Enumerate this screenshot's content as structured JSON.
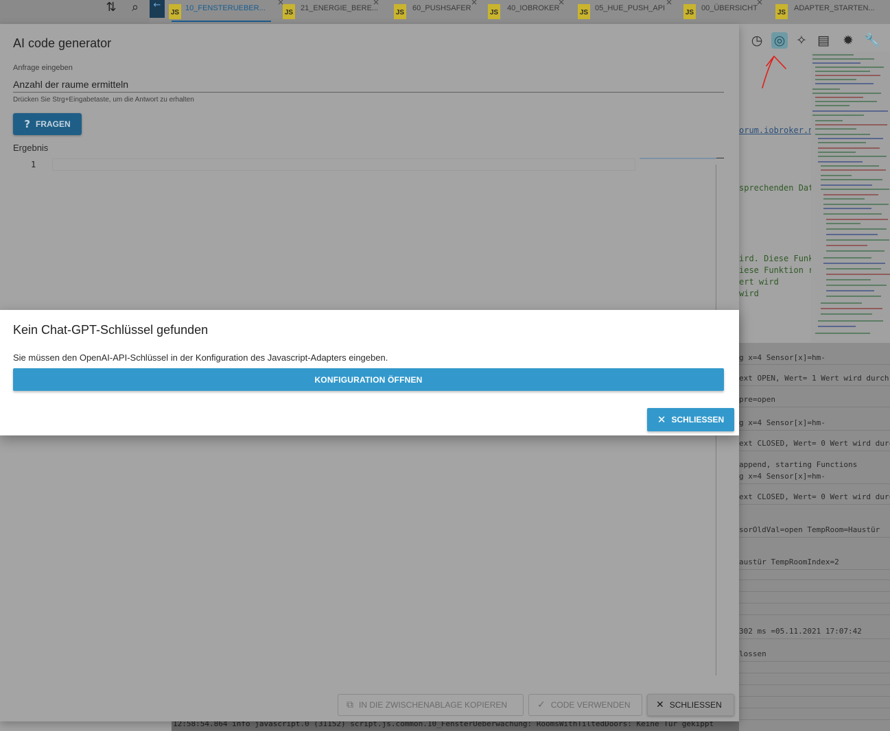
{
  "topbar": {
    "left_icons": [
      "sort-icon",
      "search-icon"
    ],
    "back_glyph": "←",
    "tabs": [
      {
        "badge": "JS",
        "name": "10_FENSTERUEBER...",
        "active": true
      },
      {
        "badge": "JS",
        "name": "21_ENERGIE_BERE..."
      },
      {
        "badge": "JS",
        "name": "60_PUSHSAFER"
      },
      {
        "badge": "JS",
        "name": "40_IOBROKER"
      },
      {
        "badge": "JS",
        "name": "05_HUE_PUSH_API"
      },
      {
        "badge": "JS",
        "name": "00_ÜBERSICHT"
      },
      {
        "badge": "JS",
        "name": "ADAPTER_STARTEN..."
      }
    ],
    "close_glyph": "×"
  },
  "right_toolbar": {
    "icons": [
      "clock-icon",
      "openai-icon",
      "sparkle-icon",
      "clipboard-icon",
      "bug-icon",
      "wrench-icon"
    ],
    "glyphs": [
      "◷",
      "◎",
      "✧",
      "▤",
      "✹",
      "🔧"
    ]
  },
  "code_snippets": [
    "orum.iobroker.n",
    "sprechenden Dat",
    "ird. Diese Funk",
    "iese Funktion r",
    "ert wird",
    "wird"
  ],
  "log_lines": [
    "g x=4 Sensor[x]=hm-",
    "ext OPEN, Wert= 1 Wert wird durch",
    "pre=open",
    "g x=4 Sensor[x]=hm-",
    "ext CLOSED, Wert= 0 Wert wird durch",
    "append, starting Functions",
    "g x=4 Sensor[x]=hm-",
    "ext CLOSED, Wert= 0 Wert wird durch",
    "sorOldVal=open TempRoom=Haustür",
    "austür TempRoomIndex=2",
    "302 ms =05.11.2021 17:07:42",
    "lossen"
  ],
  "bottom_log": "12:58:54.864 info  javascript.0 (31152) script.js.common.10_FensterUeberwachung: RoomsWithTiltedDoors: Keine Tür gekippt",
  "ai_dialog": {
    "title": "AI code generator",
    "request_label": "Anfrage eingeben",
    "request_value": "Anzahl der raume ermitteln",
    "request_help": "Drücken Sie Strg+Eingabetaste, um die Antwort zu erhalten",
    "ask_button": "FRAGEN",
    "result_label": "Ergebnis",
    "line_number": "1",
    "copy_button": "IN DIE ZWISCHENABLAGE KOPIEREN",
    "use_code_button": "CODE VERWENDEN",
    "close_button": "SCHLIESSEN"
  },
  "alert": {
    "title": "Kein Chat-GPT-Schlüssel gefunden",
    "message": "Sie müssen den OpenAI-API-Schlüssel in der Konfiguration des Javascript-Adapters eingeben.",
    "config_button": "KONFIGURATION ÖFFNEN",
    "close_button": "SCHLIESSEN"
  },
  "colors": {
    "primary": "#3399cc",
    "annotation_red": "#e0201a"
  }
}
